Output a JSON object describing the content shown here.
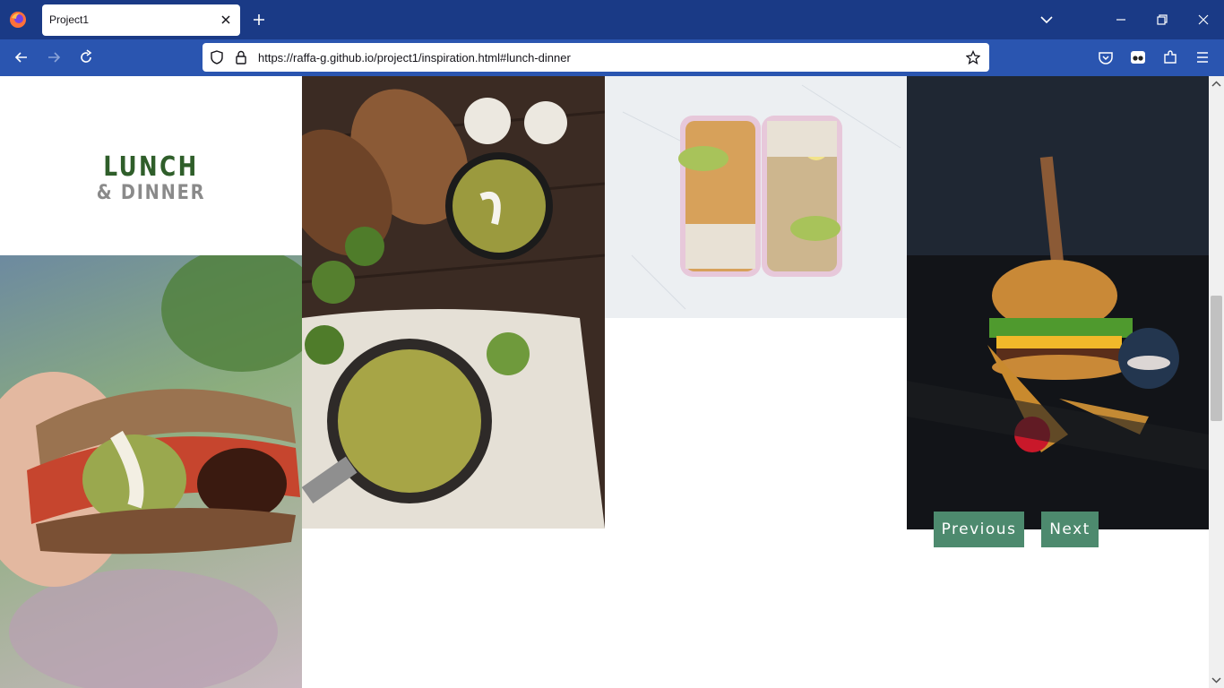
{
  "browser": {
    "tab_title": "Project1",
    "url": "https://raffa-g.github.io/project1/inspiration.html#lunch-dinner",
    "colors": {
      "tabbar": "#1a3a86",
      "navbar": "#2a55b0"
    }
  },
  "page": {
    "heading": {
      "line1": "LUNCH",
      "line2": "& DINNER"
    },
    "buttons": {
      "previous": "Previous",
      "next": "Next"
    },
    "colors": {
      "heading_green": "#2f5e2a",
      "heading_gray": "#8a8a8a",
      "button": "#4d8a6e"
    }
  }
}
